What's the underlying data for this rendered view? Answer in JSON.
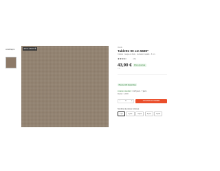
{
  "brand": {
    "name": "cotélitapis"
  },
  "gallery": {
    "badge": "EXCLUSIVITÉ"
  },
  "product": {
    "vendor": "Vendu",
    "title": "Tablette 90 cm 5689*",
    "subtitle": "Coloris : taupe en bois · Livraison rapide · 5 cm",
    "stars": "★★★★☆",
    "rating_count": "(35)",
    "price": "43,90 €",
    "price_badge": "Prix le plus bas",
    "vat_note": "TTC"
  },
  "availability": {
    "stock": "Plus de 100 disponibles",
    "delivery_prefix": "Livraison standard :",
    "delivery_value": "3 à 5 jours · 7 jours",
    "pickup": "Retrait : 1,00 €"
  },
  "buy": {
    "qty_minus": "−",
    "qty_value": "1",
    "qty_plus": "+",
    "add_to_cart": "AJOUTER AU PANIER"
  },
  "options": {
    "label": "Nombre de pièces incluses",
    "items": [
      "1 pc",
      "2 pcs",
      "3 pcs",
      "4 pcs",
      "5 pcs"
    ],
    "selected_index": 0
  }
}
